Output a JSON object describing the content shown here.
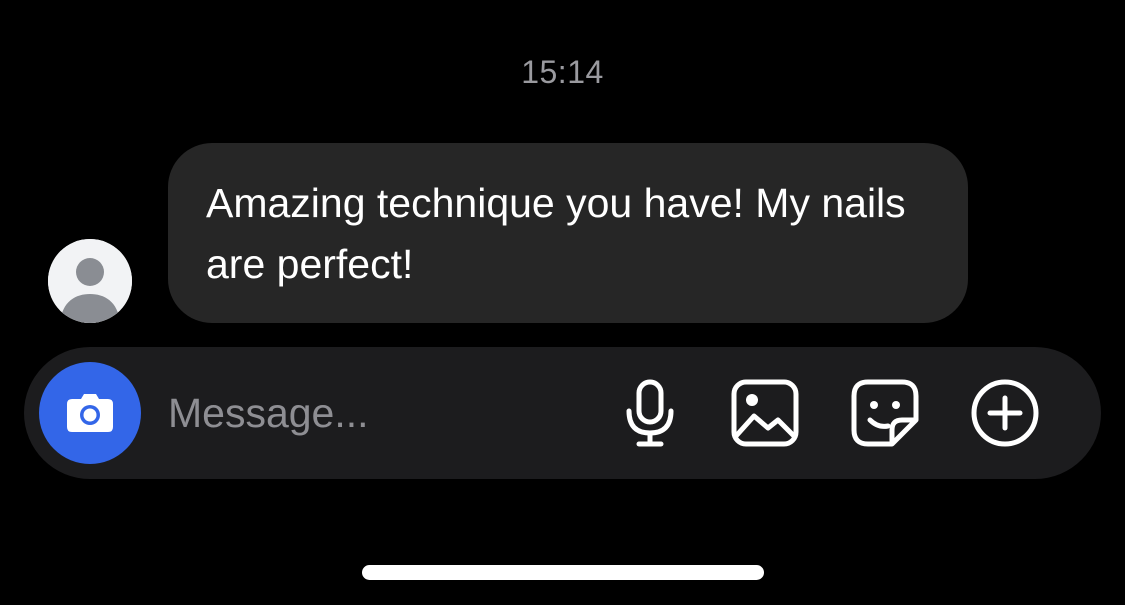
{
  "conversation": {
    "timestamp": "15:14",
    "messages": [
      {
        "direction": "incoming",
        "text": "Amazing technique you have! My nails are perfect!",
        "avatar_icon": "default-user-avatar-icon"
      }
    ]
  },
  "composer": {
    "placeholder": "Message...",
    "value": "",
    "buttons": [
      {
        "name": "camera-button",
        "icon": "camera-icon"
      },
      {
        "name": "voice-button",
        "icon": "microphone-icon"
      },
      {
        "name": "gallery-button",
        "icon": "image-icon"
      },
      {
        "name": "sticker-button",
        "icon": "sticker-icon"
      },
      {
        "name": "more-button",
        "icon": "plus-circle-icon"
      }
    ]
  },
  "colors": {
    "background": "#000000",
    "bubble": "#262626",
    "composer": "#1c1c1e",
    "accent": "#3366e8",
    "timestamp": "#9a9a9f",
    "placeholder": "#8e8e93"
  }
}
